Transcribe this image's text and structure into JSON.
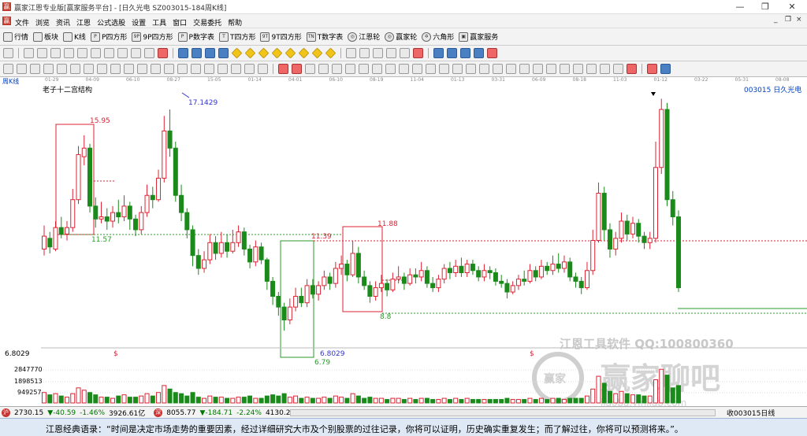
{
  "window": {
    "logo": "赢",
    "title": "赢家江恩专业版[赢家服务平台] - [日久光电  SZ003015-184周K线]",
    "controls": [
      "—",
      "❐",
      "✕"
    ],
    "mdi_controls": [
      "_",
      "❐",
      "×"
    ]
  },
  "menu": {
    "logo": "赢",
    "items": [
      "文件",
      "浏览",
      "资讯",
      "江恩",
      "公式选股",
      "设置",
      "工具",
      "窗口",
      "交易委托",
      "帮助"
    ]
  },
  "nav": {
    "items": [
      {
        "icon": "grid-icon",
        "label": "行情"
      },
      {
        "icon": "blocks-icon",
        "label": "板块"
      },
      {
        "icon": "candle-icon",
        "label": "K线"
      },
      {
        "icon": "p-icon",
        "glyph": "P",
        "label": "P四方形"
      },
      {
        "icon": "9p-icon",
        "glyph": "9P",
        "label": "9P四方形"
      },
      {
        "icon": "p-icon",
        "glyph": "P",
        "label": "P数字表"
      },
      {
        "icon": "t-icon",
        "glyph": "T",
        "label": "T四方形"
      },
      {
        "icon": "9t-icon",
        "glyph": "9T",
        "label": "9T四方形"
      },
      {
        "icon": "tn-icon",
        "glyph": "TN",
        "label": "T数字表"
      },
      {
        "icon": "wheel-icon",
        "glyph": "◎",
        "label": "江恩轮"
      },
      {
        "icon": "wheel-icon",
        "glyph": "◎",
        "label": "赢家轮"
      },
      {
        "icon": "hexagon-icon",
        "glyph": "✡",
        "label": "六角形"
      },
      {
        "icon": "service-icon",
        "glyph": "▣",
        "label": "赢家服务"
      }
    ]
  },
  "dates": {
    "label": "周K线",
    "ticks": [
      "01-29",
      "04-09",
      "06-10",
      "08-27",
      "15-05",
      "01-14",
      "04-01",
      "06-10",
      "08-19",
      "11-04",
      "01-13",
      "03-31",
      "06-09",
      "08-18",
      "11-03",
      "01-12",
      "03-22",
      "05-31",
      "08-08"
    ]
  },
  "chart": {
    "indicator_name": "老子十二宫结构",
    "stock_label": "003015 日久光电",
    "price_labels": [
      "17.1429",
      "15.95",
      "11.57",
      "11.39",
      "11.88",
      "8.8",
      "6.8029",
      "6.79",
      "6.8029"
    ],
    "dollar_marks": [
      "$",
      "$"
    ],
    "volume_labels": [
      "2847770",
      "1898513",
      "949257"
    ],
    "watermark_line1": "江恩工具软件  QQ:100800360",
    "watermark_brand": "赢家聊吧",
    "watermark_url": "jiaoba.yinjia8.com",
    "watermark_badge": "赢家"
  },
  "chart_data": {
    "type": "candlestick",
    "title": "老子十二宫结构",
    "stock": "003015 日久光电",
    "period": "周K线",
    "x_ticks": [
      "01-29",
      "04-09",
      "06-10",
      "08-27",
      "15-05",
      "01-14",
      "04-01",
      "06-10",
      "08-19",
      "11-04",
      "01-13",
      "03-31",
      "06-09",
      "08-18",
      "11-03",
      "01-12",
      "03-22",
      "05-31",
      "08-08"
    ],
    "ylim": [
      6.0,
      17.8
    ],
    "volume_ticks": [
      949257,
      1898513,
      2847770
    ],
    "annotated_levels": [
      17.1429,
      15.95,
      11.57,
      11.39,
      11.88,
      8.8,
      6.8029,
      6.79
    ],
    "candles": [
      [
        10.6,
        11.2,
        11.7,
        10.3
      ],
      [
        11.1,
        10.7,
        11.4,
        10.4
      ],
      [
        10.6,
        11.6,
        11.9,
        10.5
      ],
      [
        11.6,
        11.3,
        12.1,
        11.1
      ],
      [
        11.3,
        11.6,
        11.9,
        11.0
      ],
      [
        11.6,
        12.9,
        13.4,
        11.4
      ],
      [
        12.9,
        15.0,
        15.4,
        12.7
      ],
      [
        14.9,
        15.3,
        15.9,
        14.5
      ],
      [
        15.3,
        12.6,
        15.5,
        12.3
      ],
      [
        12.6,
        12.0,
        13.0,
        11.6
      ],
      [
        12.0,
        12.1,
        12.8,
        11.8
      ],
      [
        12.1,
        11.9,
        12.5,
        11.5
      ],
      [
        11.9,
        12.3,
        12.6,
        11.6
      ],
      [
        12.3,
        12.1,
        12.9,
        11.8
      ],
      [
        12.1,
        12.6,
        13.1,
        11.9
      ],
      [
        12.6,
        12.0,
        12.8,
        11.5
      ],
      [
        12.0,
        11.5,
        12.2,
        11.2
      ],
      [
        11.5,
        12.3,
        12.6,
        11.3
      ],
      [
        12.3,
        13.1,
        13.6,
        12.1
      ],
      [
        13.1,
        12.9,
        13.5,
        12.5
      ],
      [
        12.9,
        13.9,
        14.3,
        12.8
      ],
      [
        13.9,
        16.1,
        16.8,
        13.7
      ],
      [
        16.1,
        15.3,
        17.1,
        14.9
      ],
      [
        15.3,
        13.1,
        15.6,
        12.8
      ],
      [
        13.1,
        12.3,
        13.6,
        11.9
      ],
      [
        12.3,
        11.5,
        12.5,
        11.1
      ],
      [
        11.5,
        10.3,
        11.7,
        9.8
      ],
      [
        10.3,
        9.7,
        10.6,
        9.4
      ],
      [
        9.7,
        10.1,
        10.5,
        9.5
      ],
      [
        10.1,
        10.9,
        11.3,
        9.9
      ],
      [
        10.9,
        10.4,
        11.2,
        10.1
      ],
      [
        10.4,
        10.9,
        11.4,
        10.2
      ],
      [
        10.9,
        10.5,
        11.3,
        10.2
      ],
      [
        10.5,
        10.9,
        11.5,
        10.4
      ],
      [
        10.9,
        11.4,
        11.7,
        10.7
      ],
      [
        11.4,
        10.6,
        11.6,
        10.3
      ],
      [
        10.6,
        10.0,
        10.8,
        9.7
      ],
      [
        10.0,
        10.7,
        11.0,
        9.8
      ],
      [
        10.7,
        10.1,
        10.9,
        9.9
      ],
      [
        10.1,
        9.1,
        10.2,
        8.7
      ],
      [
        9.1,
        8.4,
        9.3,
        8.0
      ],
      [
        8.4,
        7.9,
        8.6,
        7.5
      ],
      [
        7.9,
        7.3,
        8.1,
        6.8
      ],
      [
        7.3,
        7.9,
        8.3,
        7.1
      ],
      [
        7.9,
        8.4,
        8.8,
        7.7
      ],
      [
        8.4,
        8.1,
        8.8,
        7.9
      ],
      [
        8.1,
        8.9,
        9.2,
        7.9
      ],
      [
        8.9,
        8.5,
        9.2,
        8.3
      ],
      [
        8.5,
        8.9,
        9.1,
        8.2
      ],
      [
        8.9,
        9.3,
        9.6,
        8.7
      ],
      [
        9.3,
        9.0,
        9.5,
        8.7
      ],
      [
        9.0,
        9.7,
        10.0,
        8.8
      ],
      [
        9.7,
        9.9,
        10.3,
        9.4
      ],
      [
        9.9,
        9.4,
        10.1,
        9.1
      ],
      [
        9.4,
        10.4,
        11.0,
        9.3
      ],
      [
        10.4,
        9.3,
        10.7,
        9.0
      ],
      [
        9.3,
        8.9,
        9.6,
        8.7
      ],
      [
        8.9,
        8.4,
        9.1,
        8.1
      ],
      [
        8.4,
        8.8,
        9.1,
        8.2
      ],
      [
        8.8,
        9.0,
        9.4,
        8.6
      ],
      [
        9.0,
        8.7,
        9.2,
        8.4
      ],
      [
        8.7,
        9.2,
        9.5,
        8.6
      ],
      [
        9.2,
        9.3,
        9.8,
        9.0
      ],
      [
        9.3,
        9.0,
        9.5,
        8.7
      ],
      [
        9.0,
        9.4,
        9.7,
        8.9
      ],
      [
        9.4,
        9.3,
        9.7,
        9.0
      ],
      [
        9.3,
        9.6,
        10.0,
        9.1
      ],
      [
        9.6,
        9.0,
        9.8,
        8.8
      ],
      [
        9.0,
        8.8,
        9.3,
        8.6
      ],
      [
        8.8,
        9.2,
        9.4,
        8.6
      ],
      [
        9.2,
        9.7,
        9.9,
        9.0
      ],
      [
        9.7,
        9.5,
        10.0,
        9.2
      ],
      [
        9.5,
        9.8,
        10.1,
        9.3
      ],
      [
        9.8,
        9.5,
        10.2,
        9.3
      ],
      [
        9.5,
        9.9,
        10.1,
        9.3
      ],
      [
        9.9,
        9.6,
        10.1,
        9.4
      ],
      [
        9.6,
        9.3,
        9.8,
        9.1
      ],
      [
        9.3,
        9.6,
        9.9,
        9.1
      ],
      [
        9.6,
        9.5,
        9.8,
        9.2
      ],
      [
        9.5,
        9.1,
        9.7,
        8.9
      ],
      [
        9.1,
        9.0,
        9.4,
        8.8
      ],
      [
        9.0,
        8.6,
        9.2,
        8.3
      ],
      [
        8.6,
        8.9,
        9.1,
        8.5
      ],
      [
        8.9,
        9.2,
        9.4,
        8.7
      ],
      [
        9.2,
        9.1,
        9.6,
        8.9
      ],
      [
        9.1,
        9.6,
        9.9,
        9.0
      ],
      [
        9.6,
        9.3,
        9.8,
        9.1
      ],
      [
        9.3,
        9.8,
        10.1,
        9.2
      ],
      [
        9.8,
        9.6,
        10.0,
        9.4
      ],
      [
        9.6,
        9.9,
        10.3,
        9.4
      ],
      [
        9.9,
        9.7,
        10.4,
        9.5
      ],
      [
        9.7,
        10.0,
        10.3,
        9.5
      ],
      [
        10.0,
        9.3,
        10.2,
        9.1
      ],
      [
        9.3,
        9.1,
        9.5,
        8.8
      ],
      [
        9.1,
        8.8,
        9.3,
        8.5
      ],
      [
        8.8,
        9.6,
        10.0,
        8.7
      ],
      [
        9.6,
        11.0,
        11.5,
        9.4
      ],
      [
        11.0,
        13.2,
        13.7,
        10.9
      ],
      [
        13.2,
        11.5,
        13.5,
        11.0
      ],
      [
        11.5,
        10.6,
        11.8,
        10.2
      ],
      [
        10.6,
        11.1,
        11.4,
        10.3
      ],
      [
        11.1,
        11.9,
        12.3,
        10.9
      ],
      [
        11.9,
        11.3,
        12.2,
        11.0
      ],
      [
        11.3,
        11.8,
        12.1,
        11.1
      ],
      [
        11.8,
        11.2,
        12.0,
        10.9
      ],
      [
        11.2,
        10.9,
        11.4,
        10.6
      ],
      [
        10.9,
        11.1,
        11.4,
        10.6
      ],
      [
        11.1,
        14.4,
        15.6,
        10.9
      ],
      [
        14.4,
        17.1,
        17.6,
        14.1
      ],
      [
        17.1,
        12.9,
        17.4,
        12.6
      ],
      [
        12.9,
        12.1,
        13.3,
        11.7
      ],
      [
        12.1,
        8.8,
        12.4,
        8.6
      ]
    ],
    "volumes": [
      0.9,
      0.7,
      0.8,
      0.6,
      0.5,
      0.8,
      1.3,
      1.1,
      0.9,
      0.7,
      0.5,
      0.5,
      0.4,
      0.6,
      0.7,
      0.5,
      0.5,
      0.6,
      0.8,
      0.6,
      0.9,
      1.5,
      1.2,
      0.9,
      0.8,
      0.6,
      0.9,
      0.5,
      0.4,
      0.6,
      0.5,
      0.5,
      0.4,
      0.4,
      0.5,
      0.5,
      0.6,
      0.4,
      0.4,
      0.6,
      0.7,
      0.6,
      0.8,
      0.5,
      0.6,
      0.4,
      0.5,
      0.4,
      0.4,
      0.5,
      0.4,
      0.6,
      0.5,
      0.4,
      0.8,
      0.6,
      0.4,
      0.5,
      0.4,
      0.4,
      0.3,
      0.4,
      0.4,
      0.3,
      0.4,
      0.3,
      0.4,
      0.4,
      0.3,
      0.3,
      0.4,
      0.3,
      0.4,
      0.3,
      0.4,
      0.3,
      0.3,
      0.3,
      0.3,
      0.3,
      0.3,
      0.4,
      0.3,
      0.3,
      0.3,
      0.4,
      0.3,
      0.4,
      0.3,
      0.4,
      0.4,
      0.3,
      0.4,
      0.4,
      0.4,
      0.6,
      1.2,
      2.3,
      1.7,
      1.0,
      0.8,
      1.0,
      0.8,
      0.7,
      0.7,
      0.6,
      0.6,
      2.0,
      2.9,
      2.4,
      1.3,
      1.5
    ]
  },
  "status": {
    "sh_icon": "沪",
    "sh_index": "2730.15",
    "sh_change": "▼-40.59",
    "sh_pct": "-1.46%",
    "sh_amount": "3926.61亿",
    "sz_icon": "深",
    "sz_index": "8055.77",
    "sz_change": "▼-184.71",
    "sz_pct": "-2.24%",
    "sz_amount": "4130.26",
    "right_label": "收003015日线"
  },
  "quote": {
    "text": "江恩经典语录：“时间是决定市场走势的重要因素，经过详细研究大市及个别股票的过往记录，你将可以证明，历史确实重复发生；而了解过往，你将可以预测将来。”。"
  }
}
